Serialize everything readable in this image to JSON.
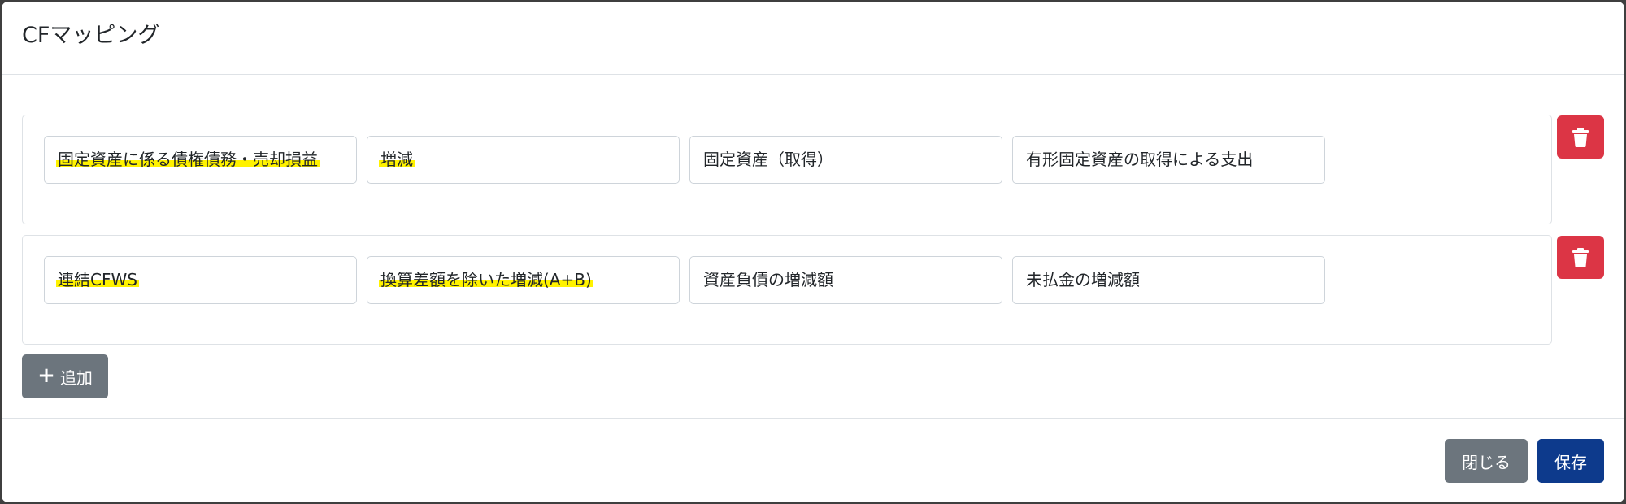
{
  "modal": {
    "title": "CFマッピング"
  },
  "rows": [
    {
      "fields": [
        {
          "value": "固定資産に係る債権債務・売却損益",
          "highlighted": true
        },
        {
          "value": "増減",
          "highlighted": true
        },
        {
          "value": "固定資産（取得）",
          "highlighted": false
        },
        {
          "value": "有形固定資産の取得による支出",
          "highlighted": false
        }
      ],
      "delete_icon": "trash-icon"
    },
    {
      "fields": [
        {
          "value": "連結CFWS",
          "highlighted": true
        },
        {
          "value": "換算差額を除いた増減(A+B)",
          "highlighted": true
        },
        {
          "value": "資産負債の増減額",
          "highlighted": false
        },
        {
          "value": "未払金の増減額",
          "highlighted": false
        }
      ],
      "delete_icon": "trash-icon"
    }
  ],
  "add_button": {
    "icon": "plus-icon",
    "label": "追加"
  },
  "footer": {
    "close_label": "閉じる",
    "save_label": "保存"
  },
  "colors": {
    "highlight": "#fff200",
    "danger": "#dc3545",
    "secondary": "#6c757d",
    "primary": "#0d3a8c"
  }
}
